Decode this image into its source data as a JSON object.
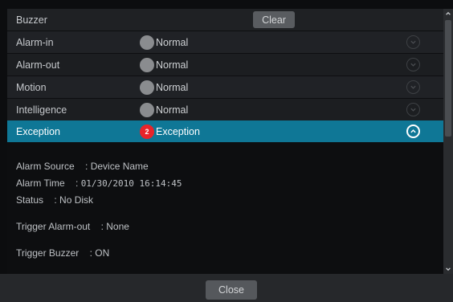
{
  "header": {
    "title": "Buzzer",
    "clear_label": "Clear"
  },
  "rows": [
    {
      "name": "Alarm-in",
      "status": "Normal"
    },
    {
      "name": "Alarm-out",
      "status": "Normal"
    },
    {
      "name": "Motion",
      "status": "Normal"
    },
    {
      "name": "Intelligence",
      "status": "Normal"
    },
    {
      "name": "Exception",
      "status": "Exception",
      "badge": "2",
      "expanded": true
    }
  ],
  "details": {
    "alarm_source": "Alarm Source    : Device Name",
    "alarm_time_label": "Alarm Time    : ",
    "alarm_time_value": "01/30/2010 16:14:45",
    "status": "Status    : No Disk",
    "trigger_alarm_out": "Trigger Alarm-out    : None",
    "trigger_buzzer": "Trigger Buzzer    : ON"
  },
  "footer": {
    "close_label": "Close"
  },
  "colors": {
    "selected_row": "#0f7796",
    "badge_red": "#e8242a",
    "status_dot": "#8a8c8f"
  },
  "icons": [
    "chevron-down-icon",
    "chevron-up-icon",
    "scroll-up-arrow-icon",
    "scroll-down-arrow-icon"
  ]
}
